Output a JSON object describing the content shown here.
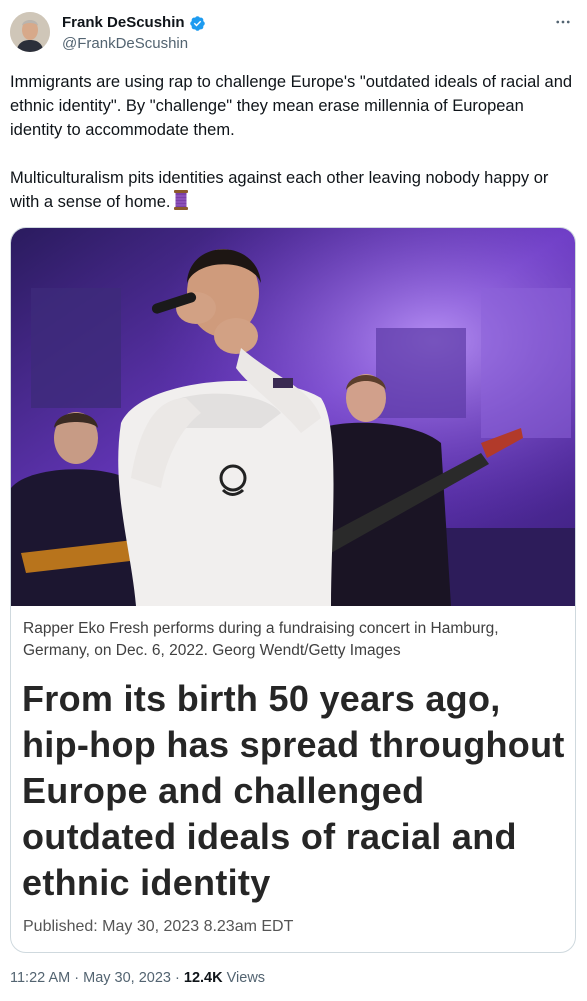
{
  "author": {
    "display_name": "Frank DeScushin",
    "handle": "@FrankDeScushin",
    "verified": true
  },
  "tweet": {
    "text": "Immigrants are using rap to challenge Europe's \"outdated ideals of racial and ethnic identity\". By \"challenge\" they mean erase millennia of European identity to accommodate them.\n\nMulticulturalism pits identities against each other leaving nobody happy or with a sense of home."
  },
  "card": {
    "caption": "Rapper Eko Fresh performs during a fundraising concert in Hamburg, Germany, on Dec. 6, 2022. Georg Wendt/Getty Images",
    "headline": "From its birth 50 years ago, hip-hop has spread throughout Europe and challenged outdated ideals of racial and ethnic identity",
    "published": "Published: May 30, 2023 8.23am EDT"
  },
  "meta": {
    "time": "11:22 AM",
    "separator": "·",
    "date": "May 30, 2023",
    "views_count": "12.4K",
    "views_label": "Views"
  },
  "icons": {
    "verified": "verified-badge-icon",
    "more": "more-options-icon",
    "spool": "thread-spool-emoji"
  },
  "colors": {
    "verified_blue": "#1d9bf0",
    "secondary_text": "#536471",
    "stage_purple": "#7a3fd0"
  }
}
